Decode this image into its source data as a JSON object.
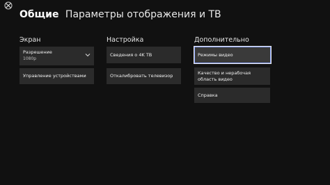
{
  "header": {
    "section": "Общие",
    "title": "Параметры отображения и ТВ"
  },
  "icons": {
    "logo": "xbox-logo-icon",
    "dropdown": "chevron-down-icon"
  },
  "columns": {
    "screen": {
      "title": "Экран",
      "resolution_label": "Разрешение",
      "resolution_value": "1080p",
      "device_control": "Управление устройствами"
    },
    "setup": {
      "title": "Настройка",
      "tv_details": "Сведения о 4K ТВ",
      "calibrate": "Откалибровать телевизор"
    },
    "advanced": {
      "title": "Дополнительно",
      "video_modes": "Режимы видео",
      "quality_overscan": "Качество и нерабочая область видео",
      "help": "Справка"
    }
  },
  "colors": {
    "background": "#111111",
    "tile": "#2b2b2b",
    "focus_border": "#e8e8e8"
  }
}
